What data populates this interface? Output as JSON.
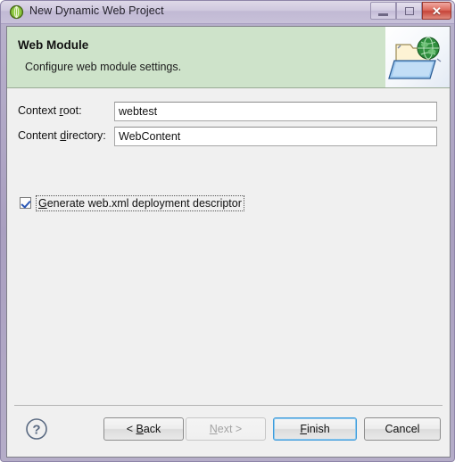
{
  "window": {
    "title": "New Dynamic Web Project",
    "title_icon": "wizard-green-circle-icon",
    "controls": {
      "minimize": "minimize-icon",
      "maximize": "maximize-icon",
      "close": "✕"
    }
  },
  "banner": {
    "title": "Web Module",
    "description": "Configure web module settings.",
    "image_icon": "folder-with-globe-icon",
    "background_color": "#cee3ca"
  },
  "form": {
    "context_root": {
      "label_before": "Context ",
      "label_mnemonic": "r",
      "label_after": "oot:",
      "value": "webtest",
      "placeholder": ""
    },
    "content_directory": {
      "label_before": "Content ",
      "label_mnemonic": "d",
      "label_after": "irectory:",
      "value": "WebContent",
      "placeholder": ""
    },
    "generate_webxml": {
      "label_mnemonic": "G",
      "label_after": "enerate web.xml deployment descriptor",
      "checked": true,
      "focused": true
    }
  },
  "buttons": {
    "help": "?",
    "back": {
      "prefix": "< ",
      "mnemonic": "B",
      "suffix": "ack",
      "enabled": true
    },
    "next": {
      "prefix": "",
      "mnemonic": "N",
      "suffix": "ext >",
      "enabled": false
    },
    "finish": {
      "prefix": "",
      "mnemonic": "F",
      "suffix": "inish",
      "enabled": true,
      "default": true
    },
    "cancel": {
      "prefix": "",
      "mnemonic": "",
      "suffix": "Cancel",
      "enabled": true
    }
  },
  "colors": {
    "banner_green": "#cee3ca",
    "default_button_focus": "#3c9bdc",
    "dialog_background": "#f0f0f0",
    "titlebar_start": "#ded9e8",
    "close_button_red": "#c6453a"
  }
}
